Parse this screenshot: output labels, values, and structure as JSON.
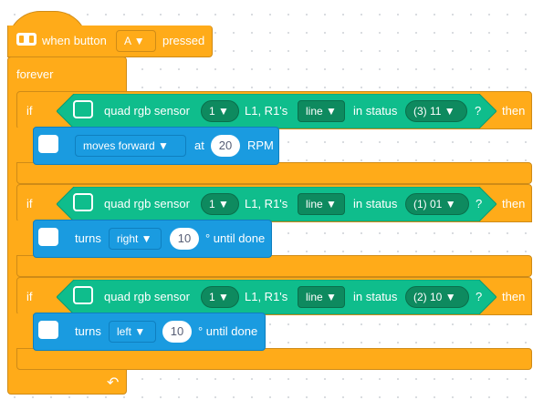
{
  "colors": {
    "control": "#ffab19",
    "sensor": "#0fbd8c",
    "motion": "#1a9be0"
  },
  "hat": {
    "prefix": "when button",
    "button_value": "A",
    "suffix": "pressed",
    "icon": "brain-icon"
  },
  "forever": {
    "label": "forever",
    "loop_icon": "loop-arrow-icon"
  },
  "if_blocks": [
    {
      "if_label": "if",
      "then_label": "then",
      "condition": {
        "sensor": "quad rgb sensor",
        "port": "1",
        "pins": "L1, R1's",
        "mode": "line",
        "status_label": "in status",
        "status_value": "(3) 11",
        "question": "?"
      },
      "action": {
        "type": "move",
        "direction": "moves forward",
        "at_label": "at",
        "speed": "20",
        "unit": "RPM"
      }
    },
    {
      "if_label": "if",
      "then_label": "then",
      "condition": {
        "sensor": "quad rgb sensor",
        "port": "1",
        "pins": "L1, R1's",
        "mode": "line",
        "status_label": "in status",
        "status_value": "(1) 01",
        "question": "?"
      },
      "action": {
        "type": "turn",
        "prefix": "turns",
        "direction": "right",
        "degrees": "10",
        "suffix": "° until done"
      }
    },
    {
      "if_label": "if",
      "then_label": "then",
      "condition": {
        "sensor": "quad rgb sensor",
        "port": "1",
        "pins": "L1, R1's",
        "mode": "line",
        "status_label": "in status",
        "status_value": "(2) 10",
        "question": "?"
      },
      "action": {
        "type": "turn",
        "prefix": "turns",
        "direction": "left",
        "degrees": "10",
        "suffix": "° until done"
      }
    }
  ]
}
